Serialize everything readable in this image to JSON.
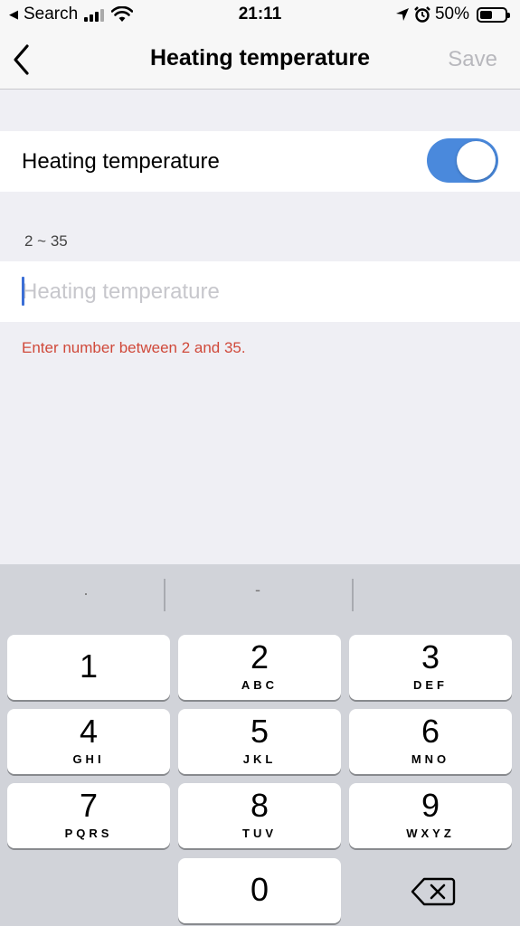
{
  "status_bar": {
    "back_app": "Search",
    "time": "21:11",
    "battery": "50%"
  },
  "nav": {
    "title": "Heating temperature",
    "save_label": "Save"
  },
  "toggle_row": {
    "label": "Heating temperature",
    "enabled": true
  },
  "input_section": {
    "range_hint": "2 ~ 35",
    "placeholder": "Heating temperature",
    "value": "",
    "error": "Enter number between 2 and 35."
  },
  "keyboard": {
    "suggestions": [
      ".",
      "-"
    ],
    "keys": [
      {
        "digit": "1",
        "letters": ""
      },
      {
        "digit": "2",
        "letters": "ABC"
      },
      {
        "digit": "3",
        "letters": "DEF"
      },
      {
        "digit": "4",
        "letters": "GHI"
      },
      {
        "digit": "5",
        "letters": "JKL"
      },
      {
        "digit": "6",
        "letters": "MNO"
      },
      {
        "digit": "7",
        "letters": "PQRS"
      },
      {
        "digit": "8",
        "letters": "TUV"
      },
      {
        "digit": "9",
        "letters": "WXYZ"
      },
      {
        "digit": "0",
        "letters": ""
      }
    ]
  },
  "colors": {
    "accent": "#4a89dc",
    "error": "#d0493a",
    "disabled": "#b8b8bd",
    "background": "#efeff4",
    "keyboard": "#d1d3d9"
  },
  "icons": {
    "back": "chevron-left-icon",
    "delete": "backspace-icon",
    "signal": "cellular-signal-icon",
    "wifi": "wifi-icon",
    "location": "location-arrow-icon",
    "alarm": "alarm-clock-icon",
    "battery": "battery-icon"
  }
}
